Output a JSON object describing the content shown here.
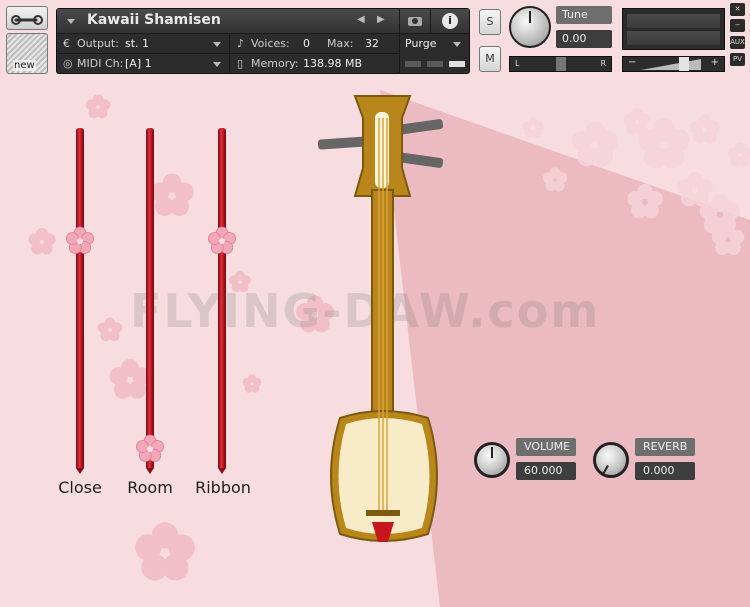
{
  "header": {
    "instrument_name": "Kawaii Shamisen",
    "output_label": "Output:",
    "output_value": "st. 1",
    "midi_label": "MIDI Ch:",
    "midi_value": "[A]  1",
    "voices_label": "Voices:",
    "voices_value": "0",
    "max_label": "Max:",
    "max_value": "32",
    "memory_label": "Memory:",
    "memory_value": "138.98 MB",
    "purge_label": "Purge",
    "info_label": "i",
    "new_label": "new",
    "solo_label": "S",
    "mute_label": "M",
    "tune_label": "Tune",
    "tune_value": "0.00",
    "pan_left": "L",
    "pan_right": "R",
    "vol_minus": "−",
    "vol_plus": "+",
    "aux_label": "AUX",
    "pv_label": "PV",
    "close_label": "✕",
    "minimize_label": "−"
  },
  "sliders": [
    {
      "label": "Close",
      "level": 0.67
    },
    {
      "label": "Room",
      "level": 0.06
    },
    {
      "label": "Ribbon",
      "level": 0.67
    }
  ],
  "knobs": {
    "volume": {
      "label": "VOLUME",
      "value": "60.000"
    },
    "reverb": {
      "label": "REVERB",
      "value": "0.000"
    }
  },
  "watermark": "FLYING-DAW.com",
  "colors": {
    "background": "#f7dde0",
    "beam": "#eab4bb",
    "slider_red": "#d42432",
    "shamisen_wood": "#b8861b",
    "blossom": "#f2a7b6"
  }
}
